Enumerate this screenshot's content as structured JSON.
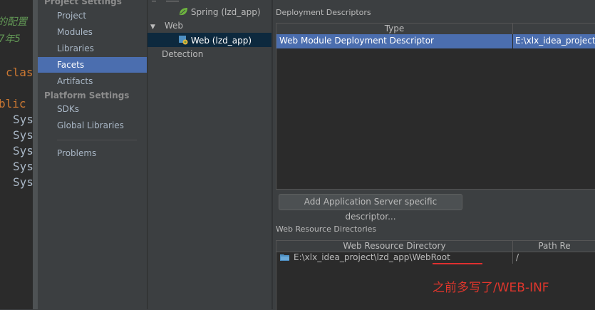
{
  "editor": {
    "lines": [
      {
        "text": "的配置",
        "color": "#629755",
        "italic": true
      },
      {
        "text": "7年5",
        "color": "#629755",
        "italic": true
      },
      {
        "text": "clas",
        "color": "#cc7832",
        "italic": false
      },
      {
        "text": "blic",
        "color": "#cc7832",
        "italic": false
      },
      {
        "text": "Sys",
        "color": "#a9b7c6",
        "italic": false
      },
      {
        "text": "Sys",
        "color": "#a9b7c6",
        "italic": false
      },
      {
        "text": "Sys",
        "color": "#a9b7c6",
        "italic": false
      },
      {
        "text": "Sys",
        "color": "#a9b7c6",
        "italic": false
      },
      {
        "text": "Sys",
        "color": "#a9b7c6",
        "italic": false
      }
    ]
  },
  "sidebar": {
    "project_settings_header": "Project Settings",
    "project_items": [
      "Project",
      "Modules",
      "Libraries",
      "Facets",
      "Artifacts"
    ],
    "selected": "Facets",
    "platform_settings_header": "Platform Settings",
    "platform_items": [
      "SDKs",
      "Global Libraries"
    ],
    "problems": "Problems"
  },
  "tree": {
    "spring": "Spring (lzd_app)",
    "web_group": "Web",
    "web_item": "Web (lzd_app)",
    "detection": "Detection"
  },
  "deployment": {
    "title": "Deployment Descriptors",
    "col_type": "Type",
    "row_type": "Web Module Deployment Descriptor",
    "row_path": "E:\\xlx_idea_project\\lz",
    "add_button": "Add Application Server specific descriptor..."
  },
  "web_resources": {
    "title": "Web Resource Directories",
    "col_dir": "Web Resource Directory",
    "col_path": "Path Re",
    "row_dir": "E:\\xlx_idea_project\\lzd_app\\WebRoot",
    "row_path": "/"
  },
  "annotation": {
    "text": "之前多写了/WEB-INF",
    "color": "#e0362c"
  },
  "colors": {
    "selection": "#4b6eaf",
    "background": "#3c3f41",
    "editor_bg": "#2b2b2b"
  }
}
